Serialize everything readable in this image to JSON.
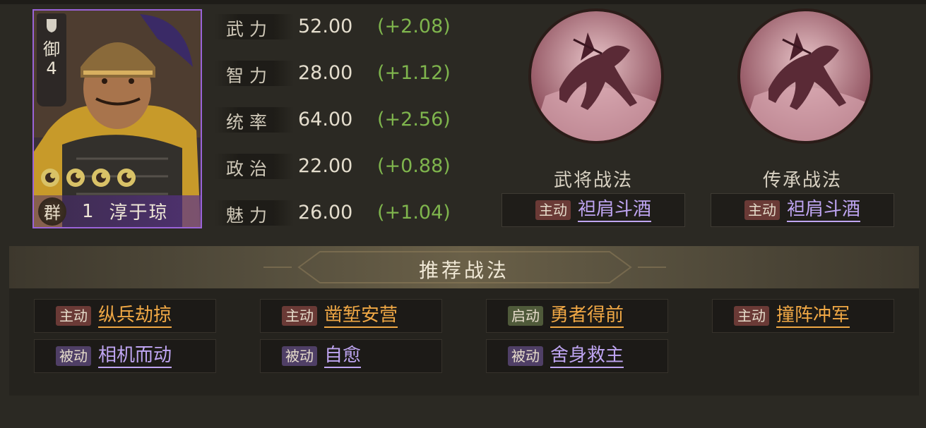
{
  "hero": {
    "troop_type": "御",
    "troop_level": "4",
    "stars": 4,
    "faction": "群",
    "cost": "1",
    "name": "淳于琼",
    "card_color": "#9a63d8"
  },
  "stats": [
    {
      "label": "武力",
      "value": "52.00",
      "bonus": "(+2.08)"
    },
    {
      "label": "智力",
      "value": "28.00",
      "bonus": "(+1.12)"
    },
    {
      "label": "统率",
      "value": "64.00",
      "bonus": "(+2.56)"
    },
    {
      "label": "政治",
      "value": "22.00",
      "bonus": "(+0.88)"
    },
    {
      "label": "魅力",
      "value": "26.00",
      "bonus": "(+1.04)"
    }
  ],
  "skills": {
    "general": {
      "title": "武将战法",
      "type": "主动",
      "name": "袒肩斗酒"
    },
    "inherit": {
      "title": "传承战法",
      "type": "主动",
      "name": "袒肩斗酒"
    }
  },
  "recommended": {
    "title": "推荐战法",
    "items": [
      {
        "type": "主动",
        "name": "纵兵劫掠"
      },
      {
        "type": "主动",
        "name": "凿堑安营"
      },
      {
        "type": "启动",
        "name": "勇者得前"
      },
      {
        "type": "主动",
        "name": "撞阵冲军"
      },
      {
        "type": "被动",
        "name": "相机而动"
      },
      {
        "type": "被动",
        "name": "自愈"
      },
      {
        "type": "被动",
        "name": "舍身救主"
      }
    ]
  },
  "colors": {
    "bonus_green": "#7fb54d",
    "skill_purple": "#bfa5f2",
    "skill_gold": "#f0a845"
  },
  "icons": [
    "shield-icon",
    "star-icon",
    "horse-rider-icon"
  ]
}
